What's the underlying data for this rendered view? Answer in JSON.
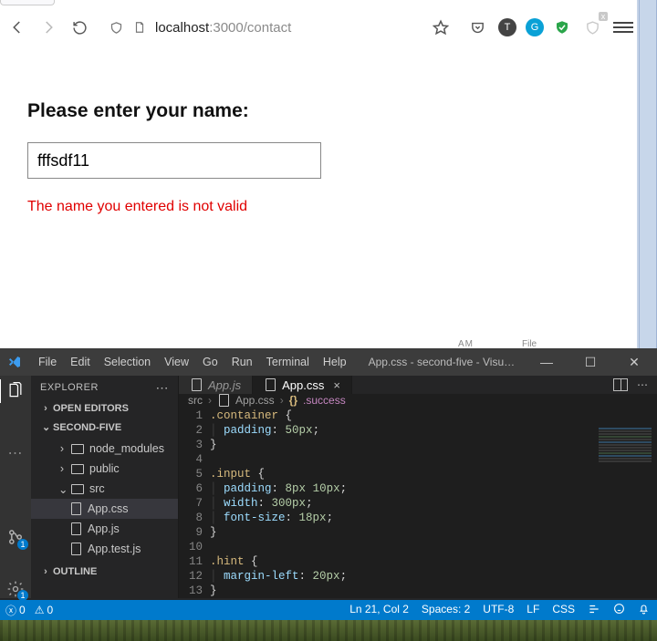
{
  "browser": {
    "url_prefix": "localhost",
    "url_rest": ":3000/contact",
    "page": {
      "heading": "Please enter your name:",
      "input_value": "fffsdf11",
      "error": "The name you entered is not valid"
    },
    "hints": {
      "am": "AM",
      "file": "File"
    }
  },
  "vscode": {
    "menus": [
      "File",
      "Edit",
      "Selection",
      "View",
      "Go",
      "Run",
      "Terminal",
      "Help"
    ],
    "title": "App.css - second-five - Visual Studio ...",
    "sidebar": {
      "title": "EXPLORER",
      "open_editors": "OPEN EDITORS",
      "project": "SECOND-FIVE",
      "outline": "OUTLINE",
      "tree": {
        "node_modules": "node_modules",
        "public": "public",
        "src": "src",
        "app_css": "App.css",
        "app_js": "App.js",
        "app_test_js": "App.test.js"
      }
    },
    "activity_badges": {
      "scm": "1",
      "settings": "1"
    },
    "tabs": {
      "appjs": "App.js",
      "appcss": "App.css"
    },
    "breadcrumbs": {
      "src": "src",
      "appcss": "App.css",
      "success": ".success"
    },
    "code": {
      "l1a": ".container",
      "l1b": " {",
      "l2a": "padding",
      "l2b": ": ",
      "l2c": "50px",
      "l2d": ";",
      "l3": "}",
      "l5a": ".input",
      "l5b": " {",
      "l6a": "padding",
      "l6b": ": ",
      "l6c": "8px",
      "l6d": " ",
      "l6e": "10px",
      "l6f": ";",
      "l7a": "width",
      "l7b": ": ",
      "l7c": "300px",
      "l7d": ";",
      "l8a": "font-size",
      "l8b": ": ",
      "l8c": "18px",
      "l8d": ";",
      "l9": "}",
      "l11a": ".hint",
      "l11b": " {",
      "l12a": "margin-left",
      "l12b": ": ",
      "l12c": "20px",
      "l12d": ";",
      "l13": "}"
    },
    "line_numbers": [
      "1",
      "2",
      "3",
      "4",
      "5",
      "6",
      "7",
      "8",
      "9",
      "10",
      "11",
      "12",
      "13"
    ],
    "status": {
      "errors": "0",
      "warnings": "0",
      "pos": "Ln 21, Col 2",
      "spaces": "Spaces: 2",
      "enc": "UTF-8",
      "eol": "LF",
      "lang": "CSS"
    }
  }
}
